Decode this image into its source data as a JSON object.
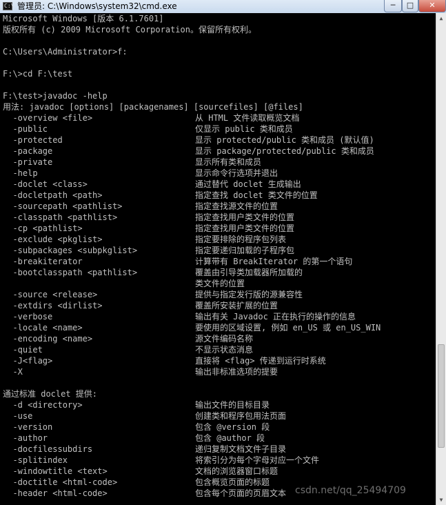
{
  "window": {
    "title": "管理员: C:\\Windows\\system32\\cmd.exe",
    "icon": "console-app-icon",
    "icon_glyph": "C:\\",
    "controls": {
      "minimize": "─",
      "maximize": "□",
      "close": "✕"
    }
  },
  "console": {
    "lines": [
      "Microsoft Windows [版本 6.1.7601]",
      "版权所有 (c) 2009 Microsoft Corporation。保留所有权利。",
      "",
      "C:\\Users\\Administrator>f:",
      "",
      "F:\\>cd F:\\test",
      "",
      "F:\\test>javadoc -help",
      "用法: javadoc [options] [packagenames] [sourcefiles] [@files]"
    ],
    "options": [
      {
        "flag": "  -overview <file>",
        "desc": "从 HTML 文件读取概览文档"
      },
      {
        "flag": "  -public",
        "desc": "仅显示 public 类和成员"
      },
      {
        "flag": "  -protected",
        "desc": "显示 protected/public 类和成员 (默认值)"
      },
      {
        "flag": "  -package",
        "desc": "显示 package/protected/public 类和成员"
      },
      {
        "flag": "  -private",
        "desc": "显示所有类和成员"
      },
      {
        "flag": "  -help",
        "desc": "显示命令行选项并退出"
      },
      {
        "flag": "  -doclet <class>",
        "desc": "通过替代 doclet 生成输出"
      },
      {
        "flag": "  -docletpath <path>",
        "desc": "指定查找 doclet 类文件的位置"
      },
      {
        "flag": "  -sourcepath <pathlist>",
        "desc": "指定查找源文件的位置"
      },
      {
        "flag": "  -classpath <pathlist>",
        "desc": "指定查找用户类文件的位置"
      },
      {
        "flag": "  -cp <pathlist>",
        "desc": "指定查找用户类文件的位置"
      },
      {
        "flag": "  -exclude <pkglist>",
        "desc": "指定要排除的程序包列表"
      },
      {
        "flag": "  -subpackages <subpkglist>",
        "desc": "指定要递归加载的子程序包"
      },
      {
        "flag": "  -breakiterator",
        "desc": "计算带有 BreakIterator 的第一个语句"
      },
      {
        "flag": "  -bootclasspath <pathlist>",
        "desc": "覆盖由引导类加载器所加载的"
      },
      {
        "flag": "",
        "desc": "类文件的位置"
      },
      {
        "flag": "  -source <release>",
        "desc": "提供与指定发行版的源兼容性"
      },
      {
        "flag": "  -extdirs <dirlist>",
        "desc": "覆盖所安装扩展的位置"
      },
      {
        "flag": "  -verbose",
        "desc": "输出有关 Javadoc 正在执行的操作的信息"
      },
      {
        "flag": "  -locale <name>",
        "desc": "要使用的区域设置, 例如 en_US 或 en_US_WIN"
      },
      {
        "flag": "  -encoding <name>",
        "desc": "源文件编码名称"
      },
      {
        "flag": "  -quiet",
        "desc": "不显示状态消息"
      },
      {
        "flag": "  -J<flag>",
        "desc": "直接将 <flag> 传递到运行时系统"
      },
      {
        "flag": "  -X",
        "desc": "输出非标准选项的提要"
      }
    ],
    "section_heading": "通过标准 doclet 提供:",
    "doclet_options": [
      {
        "flag": "  -d <directory>",
        "desc": "输出文件的目标目录"
      },
      {
        "flag": "  -use",
        "desc": "创建类和程序包用法页面"
      },
      {
        "flag": "  -version",
        "desc": "包含 @version 段"
      },
      {
        "flag": "  -author",
        "desc": "包含 @author 段"
      },
      {
        "flag": "  -docfilessubdirs",
        "desc": "递归复制文档文件子目录"
      },
      {
        "flag": "  -splitindex",
        "desc": "将索引分为每个字母对应一个文件"
      },
      {
        "flag": "  -windowtitle <text>",
        "desc": "文档的浏览器窗口标题"
      },
      {
        "flag": "  -doctitle <html-code>",
        "desc": "包含概览页面的标题"
      },
      {
        "flag": "  -header <html-code>",
        "desc": "包含每个页面的页眉文本"
      }
    ]
  },
  "scrollbar": {
    "up_icon": "▲",
    "down_icon": "▼"
  },
  "watermark": "csdn.net/qq_25494709",
  "colors": {
    "background": "#000000",
    "text": "#c0c0c0",
    "close_button": "#c74c3c"
  }
}
